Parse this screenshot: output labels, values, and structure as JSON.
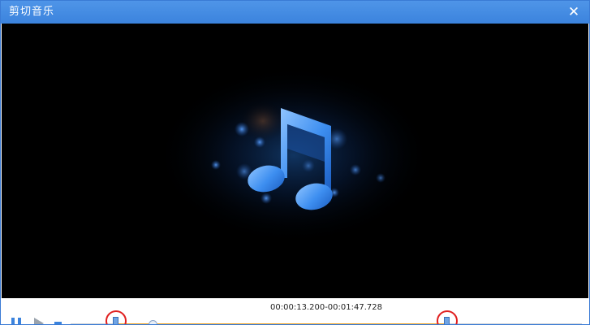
{
  "window": {
    "title": "剪切音乐",
    "close_symbol": "✕"
  },
  "video": {
    "artwork": "music-note-icon",
    "background_color": "#000000",
    "note_color": "#3d8ef0"
  },
  "controls": {
    "time_range": "00:00:13.200-00:01:47.728",
    "pause_icon": "pause-icon",
    "play_icon": "play-icon",
    "stop_icon": "stop-icon",
    "selection_color": "#f5a623",
    "marker_highlight_color": "#e02020"
  }
}
